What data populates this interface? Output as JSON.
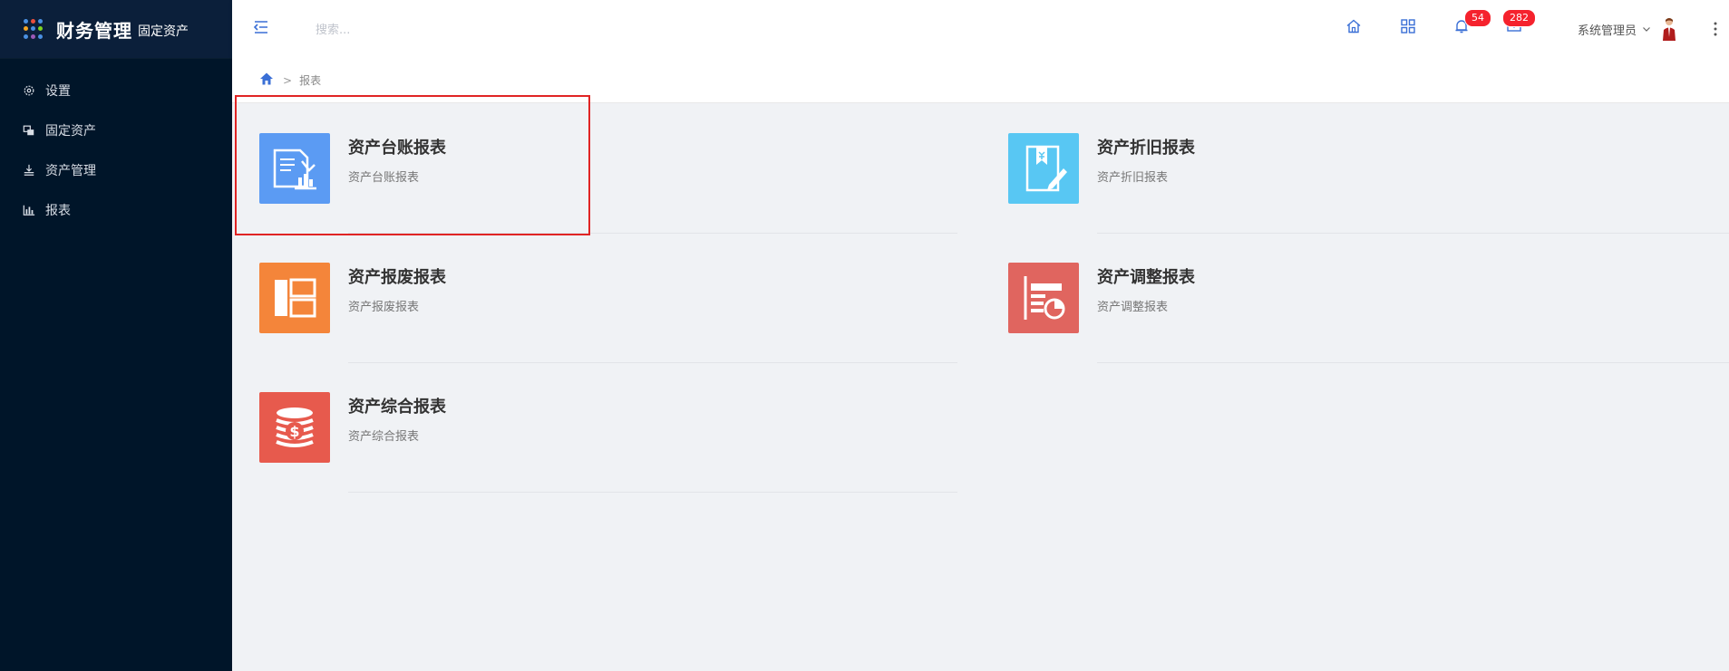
{
  "brand": {
    "title": "财务管理",
    "subtitle": "固定资产"
  },
  "colors": {
    "sidebar": "#001529",
    "accent": "#3a6fd6",
    "badge": "#f5222d"
  },
  "sidebar": {
    "items": [
      {
        "label": "设置",
        "icon": "gear-icon"
      },
      {
        "label": "固定资产",
        "icon": "asset-icon"
      },
      {
        "label": "资产管理",
        "icon": "manage-icon"
      },
      {
        "label": "报表",
        "icon": "bar-chart-icon"
      }
    ]
  },
  "header": {
    "search_placeholder": "搜索...",
    "notifications_count": "54",
    "messages_count": "282",
    "user_name": "系统管理员"
  },
  "breadcrumb": {
    "separator": ">",
    "current": "报表"
  },
  "reports": [
    {
      "title": "资产台账报表",
      "desc": "资产台账报表",
      "color": "#5b9bf3",
      "icon": "ledger-chart-icon"
    },
    {
      "title": "资产折旧报表",
      "desc": "资产折旧报表",
      "color": "#58c7f3",
      "icon": "depreciation-icon"
    },
    {
      "title": "资产报废报表",
      "desc": "资产报废报表",
      "color": "#f4853a",
      "icon": "layout-panel-icon"
    },
    {
      "title": "资产调整报表",
      "desc": "资产调整报表",
      "color": "#e0655f",
      "icon": "pie-report-icon"
    },
    {
      "title": "资产综合报表",
      "desc": "资产综合报表",
      "color": "#e75a4d",
      "icon": "coins-dollar-icon"
    }
  ]
}
